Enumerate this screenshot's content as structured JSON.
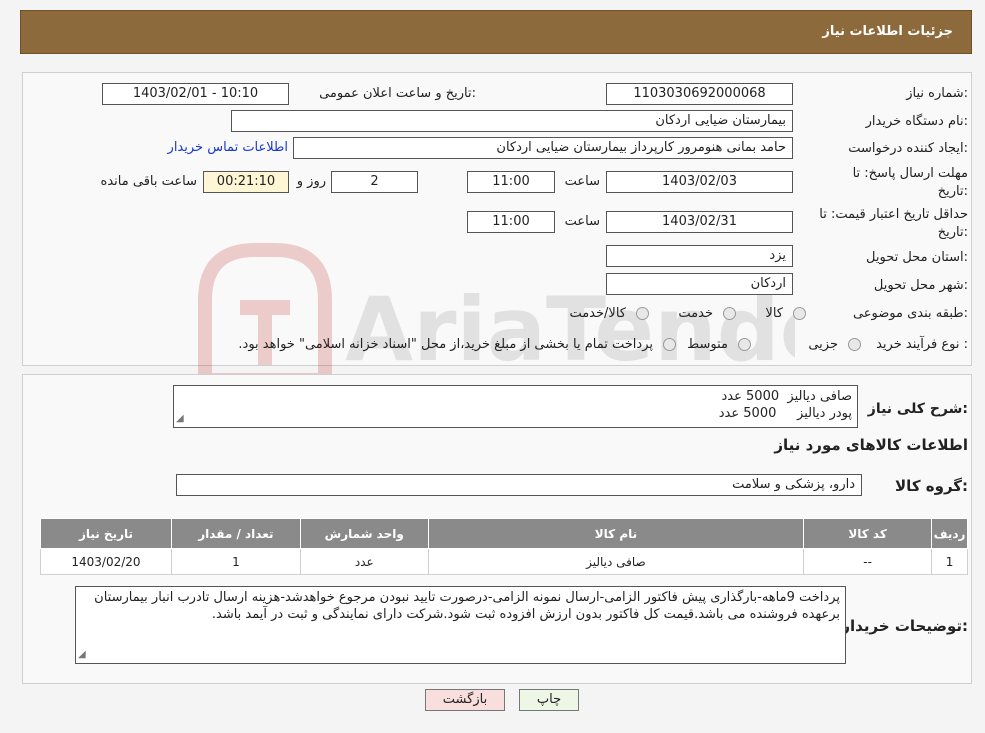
{
  "header": {
    "title": "جزئیات اطلاعات نیاز"
  },
  "watermark": {
    "text": "AriaTender.neT"
  },
  "form": {
    "need_number": {
      "label": "شماره نیاز:",
      "value": "1103030692000068"
    },
    "announce": {
      "label": "تاریخ و ساعت اعلان عمومی:",
      "value": "1403/02/01 - 10:10"
    },
    "buyer_org": {
      "label": "نام دستگاه خریدار:",
      "value": "بیمارستان ضیایی اردکان"
    },
    "creator": {
      "label": "ایجاد کننده درخواست:",
      "value": "حامد بمانی هنومرور کارپرداز بیمارستان ضیایی اردکان",
      "contact_link": "اطلاعات تماس خریدار"
    },
    "deadline": {
      "label_line1": "مهلت ارسال پاسخ: تا",
      "label_line2": "تاریخ:",
      "date": "1403/02/03",
      "time_label": "ساعت",
      "time": "11:00",
      "days": "2",
      "days_label": "روز و",
      "remaining": "00:21:10",
      "remaining_label": "ساعت باقی مانده"
    },
    "validity": {
      "label_line1": "حداقل تاریخ اعتبار قیمت: تا",
      "label_line2": "تاریخ:",
      "date": "1403/02/31",
      "time_label": "ساعت",
      "time": "11:00"
    },
    "province": {
      "label": "استان محل تحویل:",
      "value": "یزد"
    },
    "city": {
      "label": "شهر محل تحویل:",
      "value": "اردکان"
    },
    "category": {
      "label": "طبقه بندی موضوعی:",
      "options": [
        "کالا",
        "خدمت",
        "کالا/خدمت"
      ]
    },
    "purchase_type": {
      "label": "نوع فرآیند خرید :",
      "options": [
        "جزیی",
        "متوسط"
      ],
      "note": "پرداخت تمام یا بخشی از مبلغ خرید،از محل \"اسناد خزانه اسلامی\" خواهد بود."
    }
  },
  "summary": {
    "label": "شرح کلی نیاز:",
    "lines": [
      "صافی دیالیز  5000 عدد",
      "پودر دیالیز     5000 عدد"
    ]
  },
  "goods_info": {
    "title": "اطلاعات کالاهای مورد نیاز"
  },
  "goods_group": {
    "label": "گروه کالا:",
    "value": "دارو، پزشکی و سلامت"
  },
  "table": {
    "headers": [
      "ردیف",
      "کد کالا",
      "نام کالا",
      "واحد شمارش",
      "تعداد / مقدار",
      "تاریخ نیاز"
    ],
    "rows": [
      [
        "1",
        "--",
        "صافی دیالیز",
        "عدد",
        "1",
        "1403/02/20"
      ]
    ]
  },
  "buyer_notes": {
    "label": "توضیحات خریدار:",
    "text": "پرداخت 9ماهه-بارگذاری پیش فاکتور الزامی-ارسال نمونه الزامی-درصورت تایید نبودن مرجوع خواهدشد-هزینه ارسال تادرب انبار بیمارستان برعهده فروشنده می باشد.قیمت کل فاکتور بدون ارزش افزوده ثبت شود.شرکت دارای نمایندگی و ثبت در آیمد باشد."
  },
  "buttons": {
    "print": "چاپ",
    "back": "بازگشت"
  },
  "colors": {
    "header": "#8c6a3c",
    "table_header": "#8a8a8a",
    "remaining_bg": "#fff6d6",
    "back_button": "#f9dede",
    "link": "#1a39c9"
  }
}
